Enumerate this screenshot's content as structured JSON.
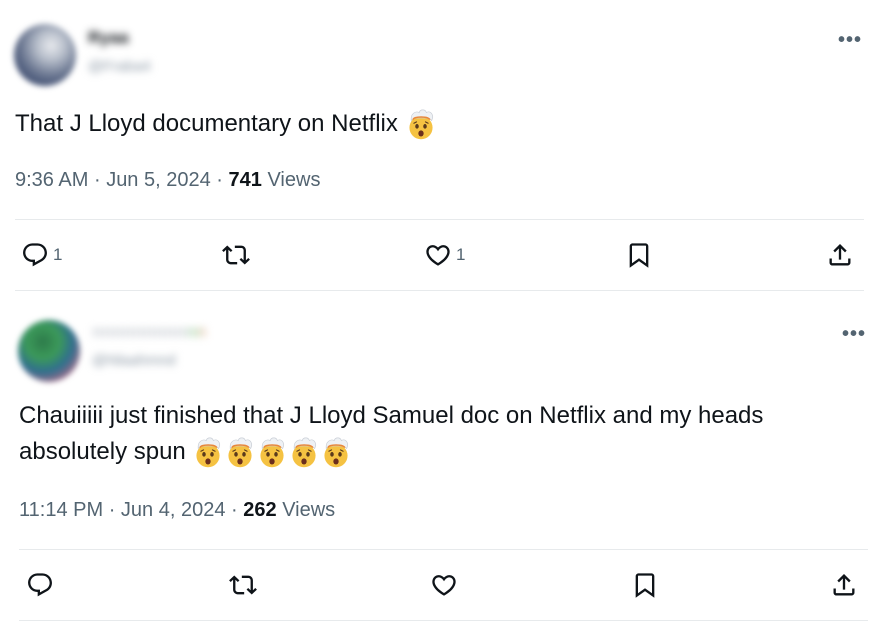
{
  "tweets": [
    {
      "author_name": "Ryaa",
      "author_handle": "@Fraba4",
      "text": "That J Lloyd documentary on Netflix",
      "emoji_count": 1,
      "time": "9:36 AM",
      "sep1": "·",
      "date": "Jun 5, 2024",
      "sep2": "·",
      "views_count": "741",
      "views_label": "Views",
      "reply_count": "1",
      "retweet_count": "",
      "like_count": "1"
    },
    {
      "author_name": "nnnnnnnnnnn",
      "author_handle": "@Nlaahmnd",
      "text_line1": "Chauiiiii just finished that J Lloyd Samuel doc on Netflix and my heads",
      "text_line2": "absolutely spun",
      "emoji_count": 5,
      "time": "11:14 PM",
      "sep1": "·",
      "date": "Jun 4, 2024",
      "sep2": "·",
      "views_count": "262",
      "views_label": "Views",
      "reply_count": "",
      "retweet_count": "",
      "like_count": ""
    }
  ],
  "icons": {
    "more": "more-icon",
    "reply": "reply-icon",
    "retweet": "retweet-icon",
    "like": "heart-icon",
    "bookmark": "bookmark-icon",
    "share": "share-icon",
    "emoji": "exploding-head-emoji"
  },
  "more_glyph": "•••",
  "colors": {
    "text": "#0f1419",
    "muted": "#536471",
    "divider": "#e7eaec"
  }
}
